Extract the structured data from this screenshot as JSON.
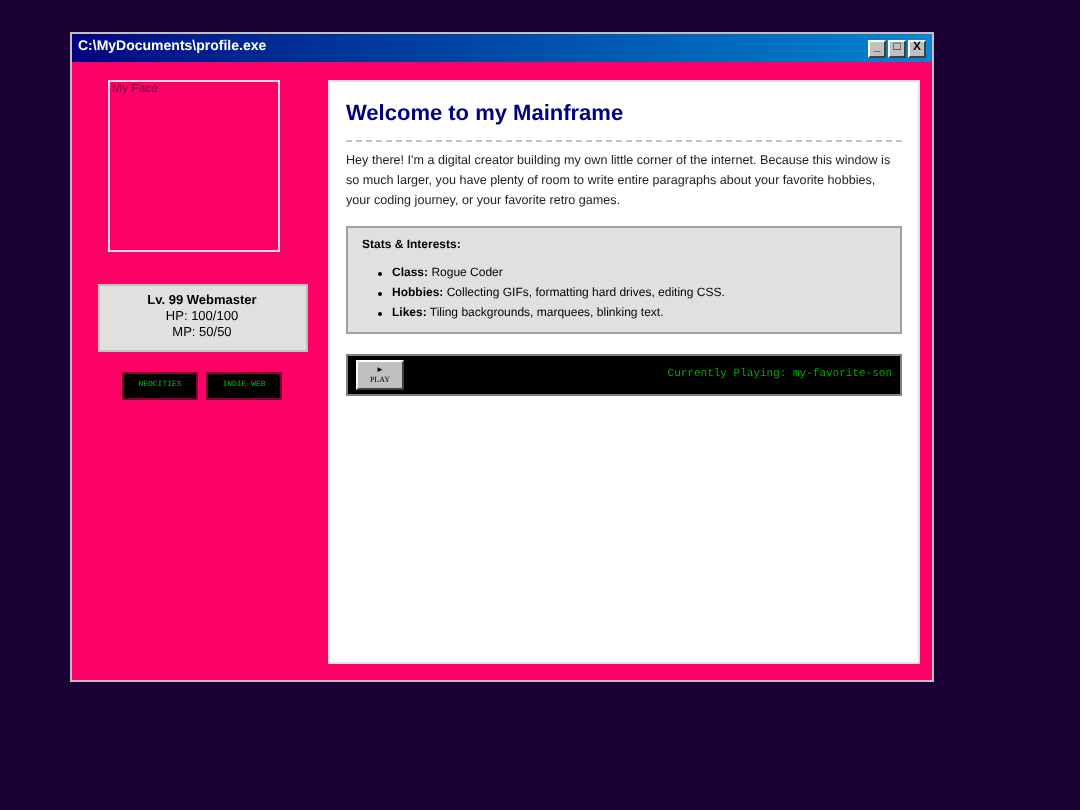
{
  "window": {
    "title": "C:\\MyDocuments\\profile.exe",
    "controls": [
      "_",
      "□",
      "X"
    ]
  },
  "sidebar": {
    "image_alt": "My Face",
    "stats": {
      "title": "Lv. 99 Webmaster",
      "lines": [
        "HP: 100/100",
        "MP: 50/50"
      ]
    },
    "buttons": [
      "NEOCITIES",
      "INDIE WEB"
    ]
  },
  "content": {
    "heading": "Welcome to my Mainframe",
    "paragraph": "Hey there! I'm a digital creator building my own little corner of the internet. Because this window is so much larger, you have plenty of room to write entire paragraphs about your favorite hobbies, your coding journey, or your favorite retro games.",
    "stats_box": {
      "title": "Stats & Interests:",
      "items": [
        {
          "label": "Class:",
          "text": "Rogue Coder"
        },
        {
          "label": "Hobbies:",
          "text": "Collecting GIFs, formatting hard drives, editing CSS."
        },
        {
          "label": "Likes:",
          "text": "Tiling backgrounds, marquees, blinking text."
        }
      ]
    },
    "player": {
      "play_icon": "►",
      "play_label": "PLAY",
      "now_playing": "Currently Playing: my-favorite-son"
    }
  }
}
